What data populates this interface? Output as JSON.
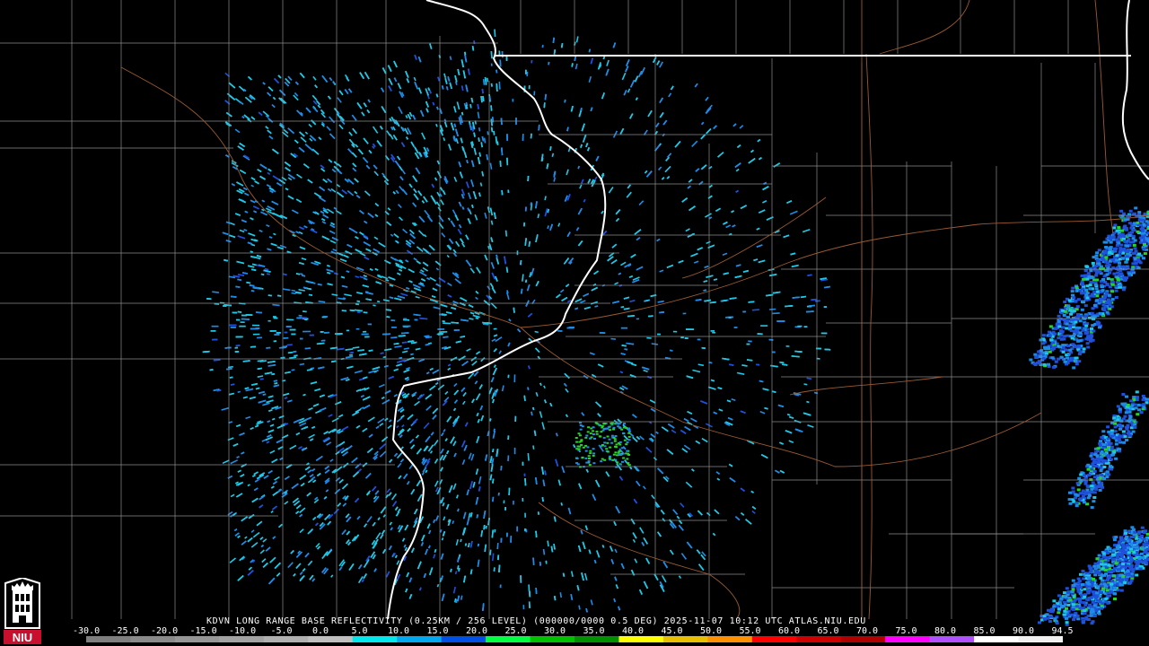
{
  "footer": {
    "title": "KDVN LONG RANGE BASE REFLECTIVITY (0.25KM / 256 LEVEL) (000000/0000 0.5 DEG) 2025-11-07 10:12 UTC  ATLAS.NIU.EDU"
  },
  "logo": {
    "text": "NIU",
    "color": "#c8102e"
  },
  "scale": {
    "labels": [
      "-30.0",
      "-25.0",
      "-20.0",
      "-15.0",
      "-10.0",
      "-5.0",
      "0.0",
      "5.0",
      "10.0",
      "15.0",
      "20.0",
      "25.0",
      "30.0",
      "35.0",
      "40.0",
      "45.0",
      "50.0",
      "55.0",
      "60.0",
      "65.0",
      "70.0",
      "75.0",
      "80.0",
      "85.0",
      "90.0",
      "94.5"
    ],
    "colors": [
      "#7f7f7f",
      "#8a8a8a",
      "#969696",
      "#a3a3a3",
      "#b0b0b0",
      "#bfbfbf",
      "#00e8ee",
      "#00a8f0",
      "#0050e8",
      "#00ff40",
      "#00c000",
      "#009000",
      "#ffff00",
      "#e8c000",
      "#ff9000",
      "#ff0000",
      "#d00000",
      "#b00000",
      "#ff00ff",
      "#b050ff",
      "#ffffff",
      "#f0f0f0"
    ]
  },
  "colors": {
    "state_border": "#ffffff",
    "county_border": "#8c8c8c",
    "road": "#9b5a32",
    "echo_light": "#1ec8e6",
    "echo_mid": "#1e8ce6",
    "echo_dark": "#1e50dc",
    "echo_green": "#28d228",
    "background": "#000000"
  }
}
